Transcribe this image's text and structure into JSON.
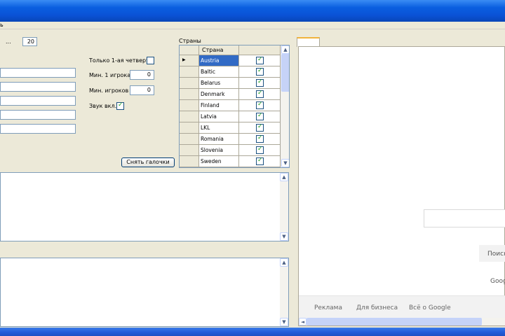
{
  "menu": {
    "item1": "ь"
  },
  "top": {
    "dots": "...",
    "count": "20"
  },
  "options": {
    "only_first_quarter": "Только 1-ая четверть",
    "min_one_player": "Мин. 1 игрока",
    "min_one_player_value": "0",
    "min_players": "Мин. игроков",
    "min_players_value": "0",
    "sound_on": "Звук вкл.",
    "sound_checked": true
  },
  "uncheck_button": "Снять галочки",
  "countries": {
    "group_label": "Страны",
    "column_header": "Страна",
    "rows": [
      {
        "name": "Austria",
        "checked": true,
        "selected": true
      },
      {
        "name": "Baltic",
        "checked": true
      },
      {
        "name": "Belarus",
        "checked": true
      },
      {
        "name": "Denmark",
        "checked": true
      },
      {
        "name": "Finland",
        "checked": true
      },
      {
        "name": "Latvia",
        "checked": true
      },
      {
        "name": "LKL",
        "checked": true
      },
      {
        "name": "Romania",
        "checked": true
      },
      {
        "name": "Slovenia",
        "checked": true
      },
      {
        "name": "Sweden",
        "checked": true
      }
    ]
  },
  "browser": {
    "search_button": "Поиск",
    "google_text": "Goog",
    "footer_links": [
      "Реклама",
      "Для бизнеса",
      "Всё о Google"
    ]
  },
  "colors": {
    "titlebar": "#0a52d6",
    "selection": "#316ac5",
    "check": "#21a121"
  }
}
